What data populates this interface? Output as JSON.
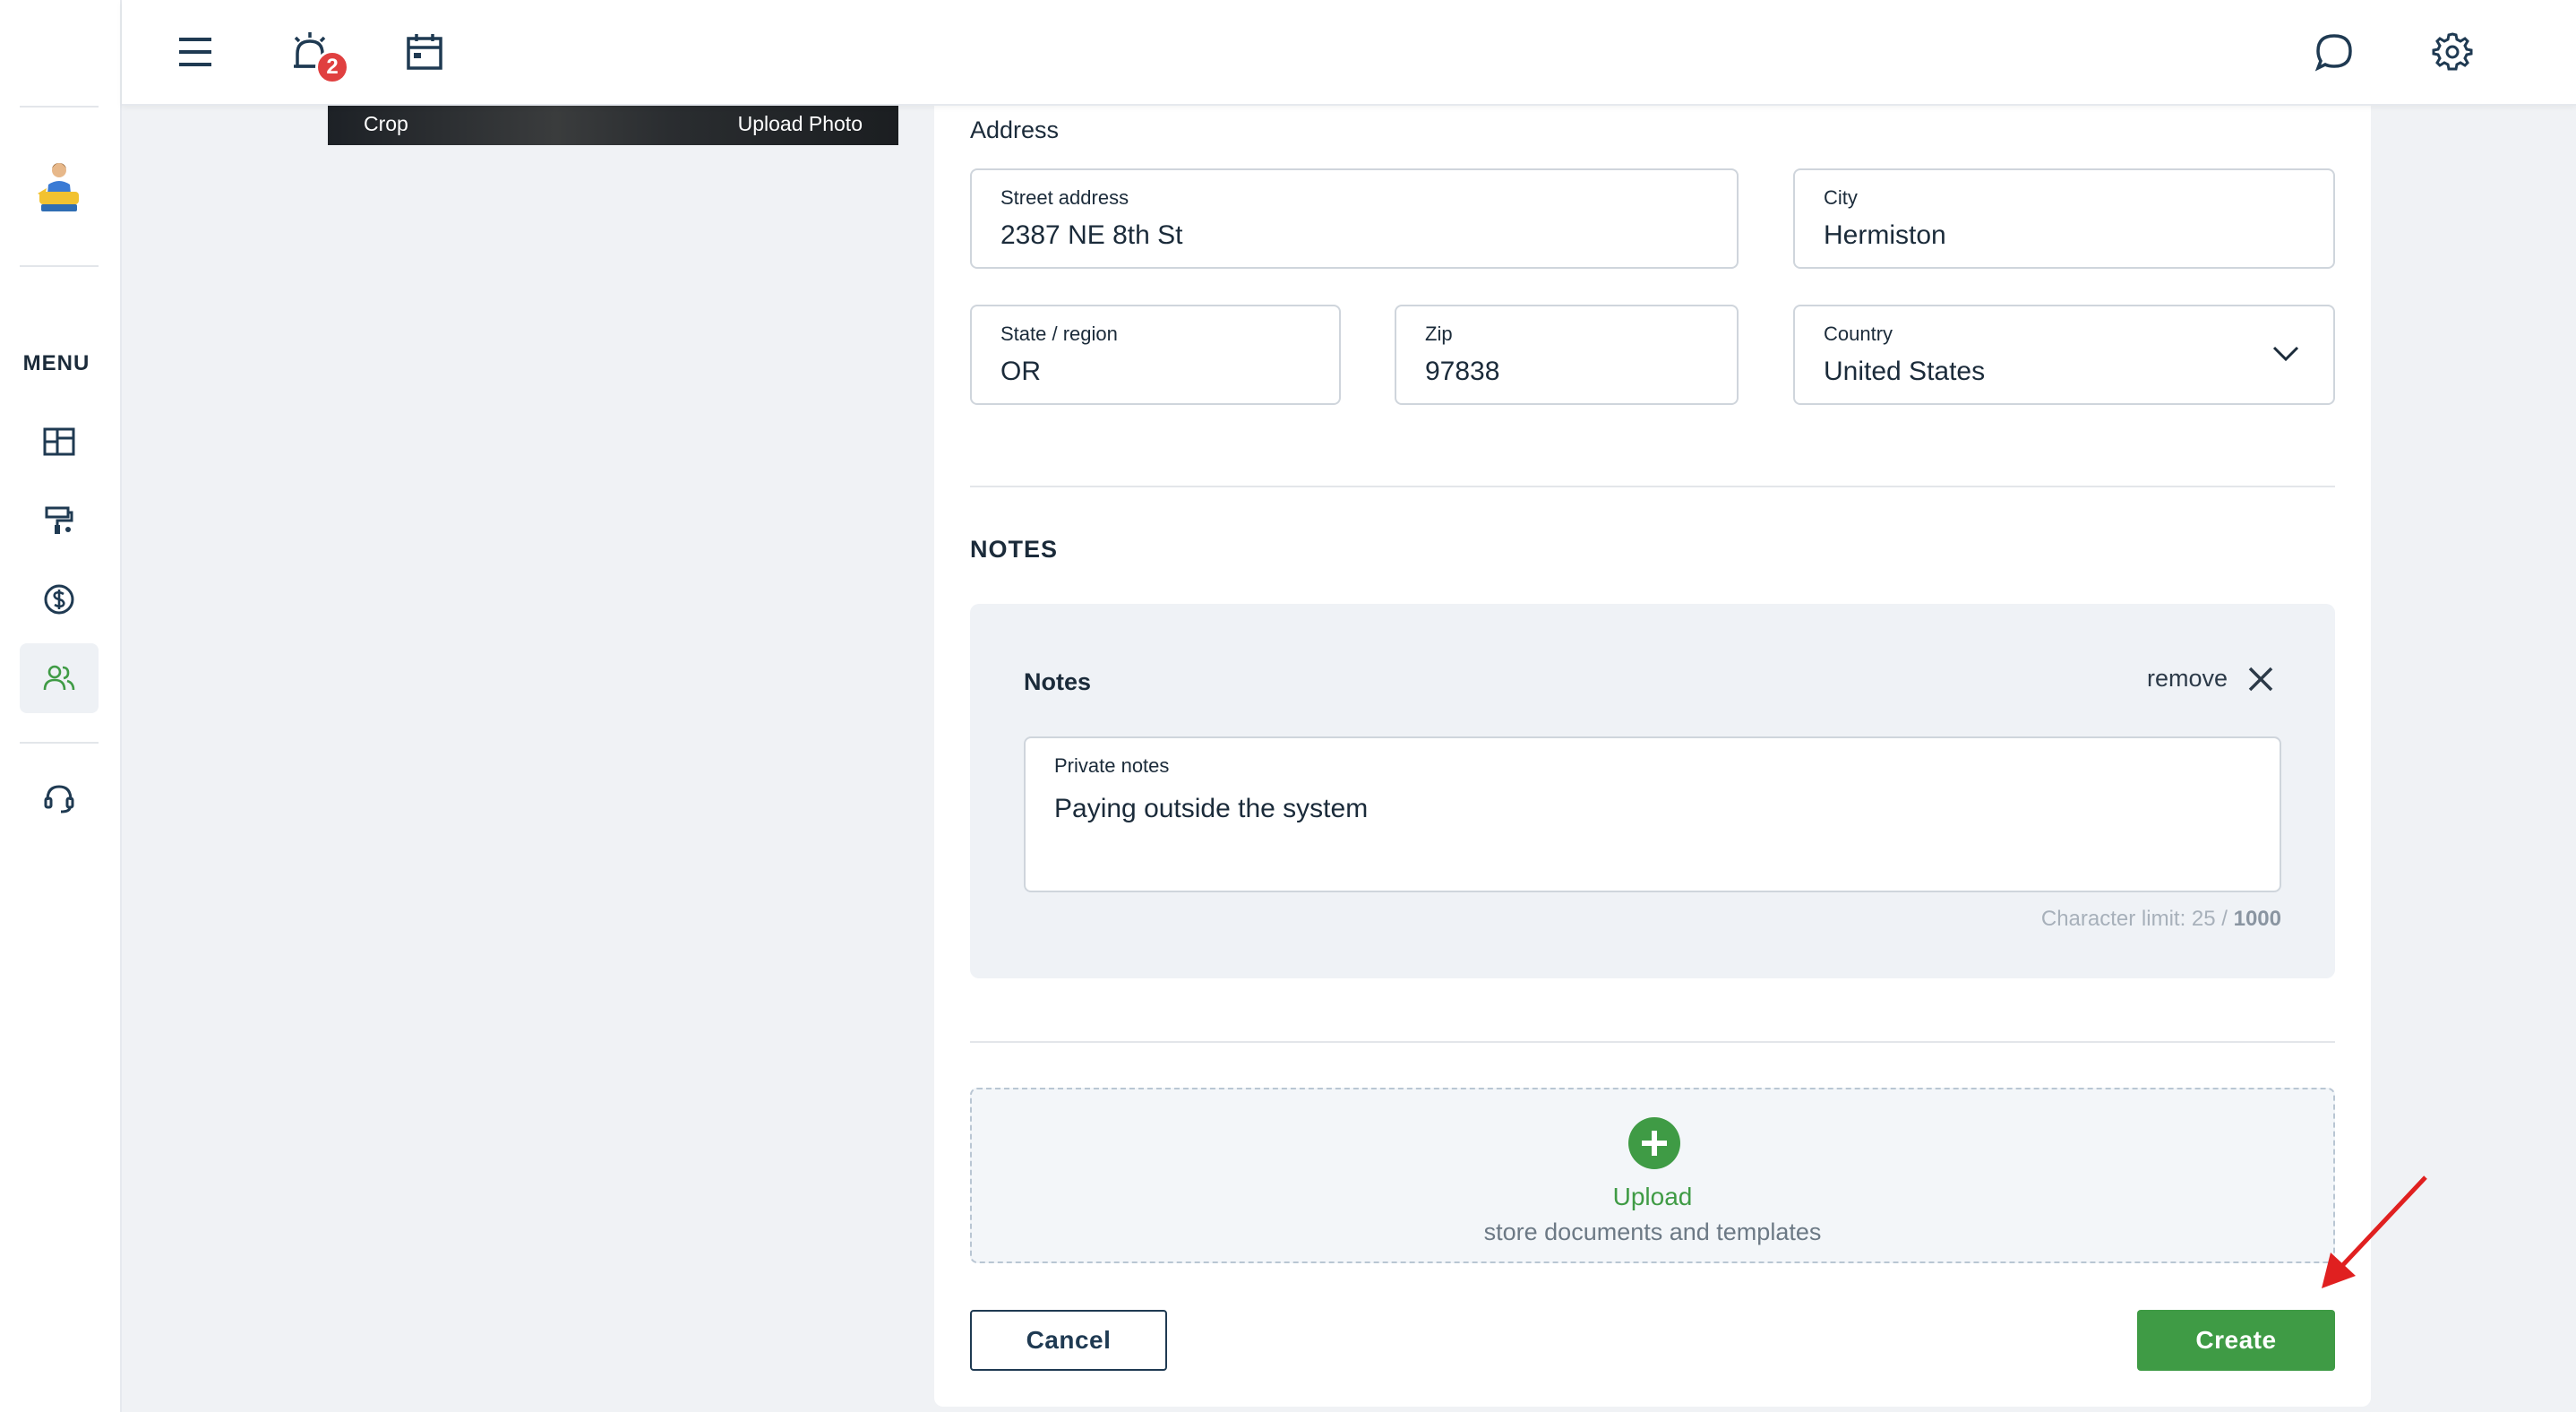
{
  "rail": {
    "menu_label": "MENU",
    "items": [
      {
        "icon": "dashboard-icon"
      },
      {
        "icon": "paint-roller-icon"
      },
      {
        "icon": "dollar-icon"
      },
      {
        "icon": "users-icon",
        "active": true
      },
      {
        "icon": "headset-icon"
      }
    ]
  },
  "topbar": {
    "notifications_count": "2"
  },
  "photo": {
    "crop_label": "Crop",
    "upload_label": "Upload Photo"
  },
  "address": {
    "title": "Address",
    "street": {
      "label": "Street address",
      "value": "2387 NE 8th St"
    },
    "city": {
      "label": "City",
      "value": "Hermiston"
    },
    "state": {
      "label": "State / region",
      "value": "OR"
    },
    "zip": {
      "label": "Zip",
      "value": "97838"
    },
    "country": {
      "label": "Country",
      "value": "United States"
    }
  },
  "notes": {
    "section_title": "NOTES",
    "panel_label": "Notes",
    "remove_label": "remove",
    "private": {
      "label": "Private notes",
      "value": "Paying outside the system"
    },
    "char_limit_text": "Character limit: 25 / ",
    "char_limit_max": "1000"
  },
  "upload": {
    "label": "Upload",
    "sub": "store documents and templates"
  },
  "actions": {
    "cancel": "Cancel",
    "create": "Create"
  },
  "colors": {
    "accent_green": "#3f9b45",
    "navy": "#1f3a52",
    "badge_red": "#e04040",
    "annotation_red": "#e02020"
  }
}
